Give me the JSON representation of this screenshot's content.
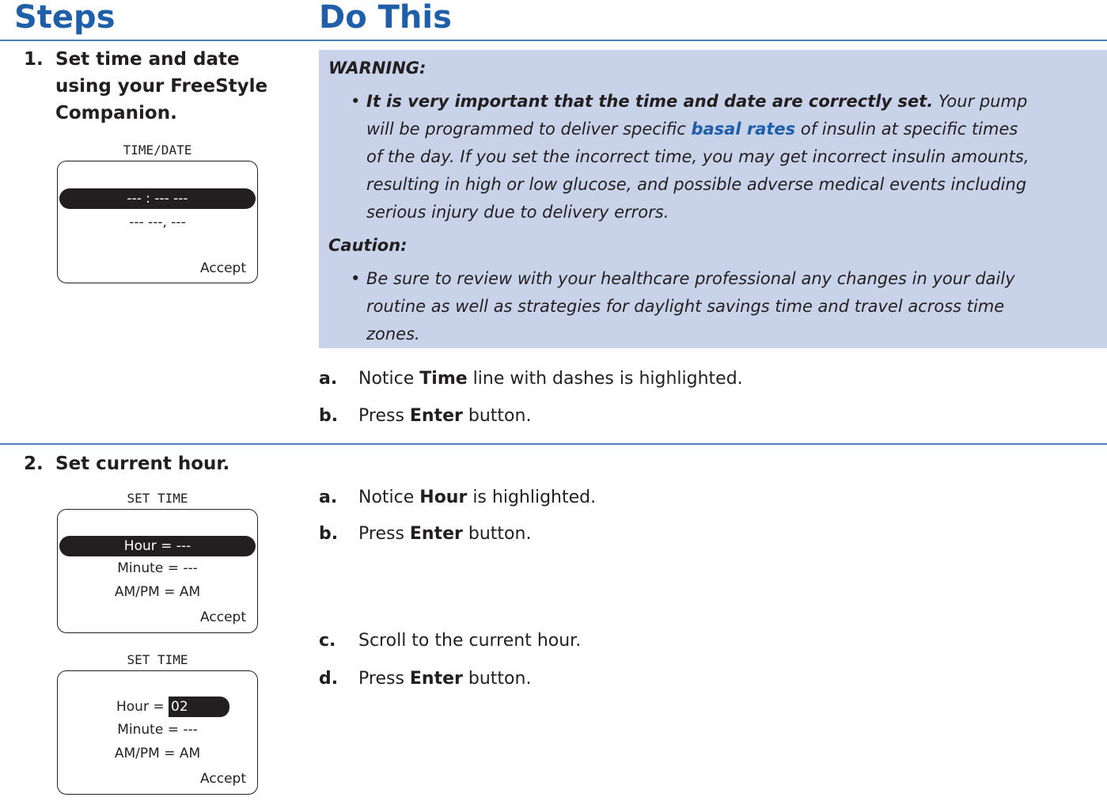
{
  "headers": {
    "steps": "Steps",
    "do_this": "Do This"
  },
  "step1": {
    "number": "1.",
    "title_lines": [
      "Set time and date",
      "using your FreeStyle",
      "Companion."
    ],
    "screen": {
      "title": "TIME/DATE",
      "highlight": "--- : ---  ---",
      "line2": "--- ---, ---",
      "accept": "Accept"
    },
    "warning": {
      "heading": "WARNING:",
      "bold_lead": "It is very important that the time and date are correctly set.",
      "line1_rest": " Your pump",
      "line2_pre": "will be programmed to deliver specific ",
      "link": "basal rates",
      "line2_post": " of insulin at specific times",
      "lines": [
        "of the day. If you set the incorrect time, you may get incorrect insulin amounts,",
        "resulting in high or low glucose, and possible adverse medical events including",
        "serious injury due to delivery errors."
      ]
    },
    "caution": {
      "heading": "Caution:",
      "lines": [
        "Be sure to review with your healthcare professional any changes in your daily",
        "routine as well as strategies for daylight savings time and travel across time",
        "zones."
      ]
    },
    "substeps": [
      {
        "letter": "a.",
        "pre": "Notice ",
        "bold": "Time",
        "post": " line with dashes is highlighted."
      },
      {
        "letter": "b.",
        "pre": "Press ",
        "bold": "Enter",
        "post": " button."
      }
    ]
  },
  "step2": {
    "number": "2.",
    "title": "Set current hour.",
    "screen1": {
      "title": "SET TIME",
      "highlight": "Hour = ---",
      "minute": "Minute = ---",
      "ampm": "AM/PM = AM",
      "accept": "Accept"
    },
    "screen2": {
      "title": "SET TIME",
      "hour_label": "Hour = ",
      "hour_value": "02",
      "minute": "Minute = ---",
      "ampm": "AM/PM = AM",
      "accept": "Accept"
    },
    "substeps": [
      {
        "letter": "a.",
        "pre": "Notice ",
        "bold": "Hour",
        "post": " is highlighted."
      },
      {
        "letter": "b.",
        "pre": "Press ",
        "bold": "Enter",
        "post": " button."
      },
      {
        "letter": "c.",
        "pre": "Scroll to the current hour.",
        "bold": "",
        "post": ""
      },
      {
        "letter": "d.",
        "pre": "Press ",
        "bold": "Enter",
        "post": " button."
      }
    ]
  }
}
